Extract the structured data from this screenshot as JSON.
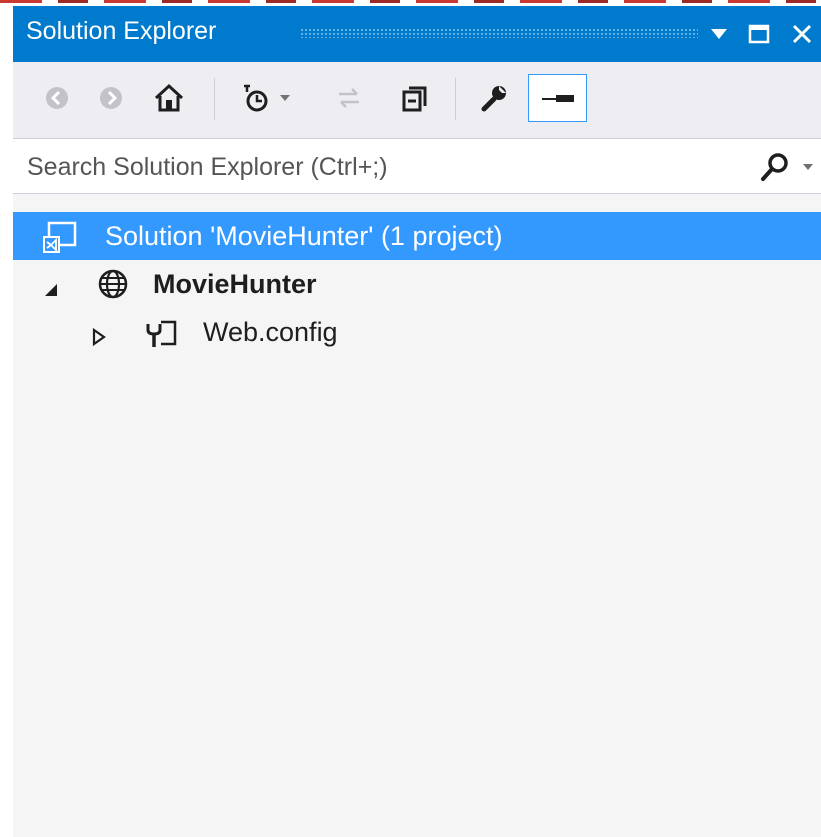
{
  "window": {
    "title": "Solution Explorer"
  },
  "search": {
    "placeholder": "Search Solution Explorer (Ctrl+;)"
  },
  "tree": {
    "solution_label": "Solution 'MovieHunter' (1 project)",
    "project_label": "MovieHunter",
    "file_label": "Web.config"
  },
  "colors": {
    "accent": "#007acc",
    "selection": "#3399ff",
    "toolbar_bg": "#eeeef2",
    "tree_bg": "#f5f5f5"
  },
  "icons": {
    "title_bar": [
      "dropdown-icon",
      "maximize-icon",
      "close-icon"
    ],
    "toolbar": [
      "back-icon",
      "forward-icon",
      "home-icon",
      "pending-changes-filter-icon",
      "dropdown-arrow-icon",
      "sync-icon",
      "collapse-all-icon",
      "properties-icon",
      "preview-icon"
    ],
    "search": "search-icon",
    "tree": [
      "solution-icon",
      "web-project-icon",
      "config-file-icon"
    ]
  }
}
